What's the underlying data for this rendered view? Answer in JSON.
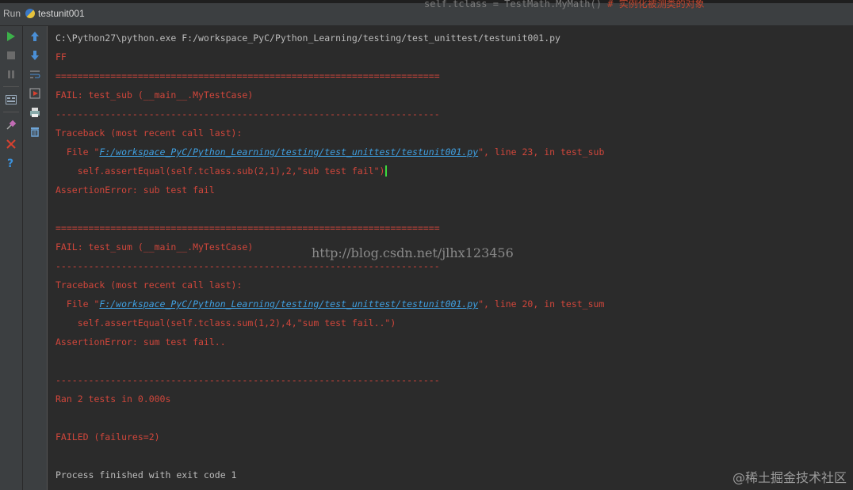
{
  "window": {
    "panel_label": "Run",
    "tab_label": "testunit001",
    "bg_code_text": "self.tclass = TestMath.MyMath()",
    "bg_code_suffix": "  # 实例化被测类的对象"
  },
  "toolbar_left": {
    "icons": [
      "run-icon",
      "stop-icon",
      "pause-icon",
      "layout-icon",
      "pin-icon",
      "close-icon",
      "help-icon"
    ]
  },
  "toolbar_right": {
    "icons": [
      "up-arrow-icon",
      "down-arrow-icon",
      "soft-wrap-icon",
      "scroll-to-end-icon",
      "print-icon",
      "trash-icon"
    ]
  },
  "console": {
    "lines": [
      {
        "text": "C:\\Python27\\python.exe F:/workspace_PyC/Python_Learning/testing/test_unittest/testunit001.py",
        "color": "gray"
      },
      {
        "text": "FF",
        "color": "red"
      },
      {
        "text": "======================================================================",
        "color": "red"
      },
      {
        "text": "FAIL: test_sub (__main__.MyTestCase)",
        "color": "red"
      },
      {
        "text": "----------------------------------------------------------------------",
        "color": "red"
      },
      {
        "text": "Traceback (most recent call last):",
        "color": "red"
      },
      {
        "text_pre": "  File \"",
        "link": "F:/workspace_PyC/Python_Learning/testing/test_unittest/testunit001.py",
        "text_post": "\", line 23, in test_sub",
        "color": "red"
      },
      {
        "text": "    self.assertEqual(self.tclass.sub(2,1),2,\"sub test fail\")",
        "color": "red",
        "caret": true
      },
      {
        "text": "AssertionError: sub test fail",
        "color": "red"
      },
      {
        "text": "",
        "color": "red"
      },
      {
        "text": "======================================================================",
        "color": "red"
      },
      {
        "text": "FAIL: test_sum (__main__.MyTestCase)",
        "color": "red"
      },
      {
        "text": "----------------------------------------------------------------------",
        "color": "red"
      },
      {
        "text": "Traceback (most recent call last):",
        "color": "red"
      },
      {
        "text_pre": "  File \"",
        "link": "F:/workspace_PyC/Python_Learning/testing/test_unittest/testunit001.py",
        "text_post": "\", line 20, in test_sum",
        "color": "red"
      },
      {
        "text": "    self.assertEqual(self.tclass.sum(1,2),4,\"sum test fail..\")",
        "color": "red"
      },
      {
        "text": "AssertionError: sum test fail..",
        "color": "red"
      },
      {
        "text": "",
        "color": "red"
      },
      {
        "text": "----------------------------------------------------------------------",
        "color": "red"
      },
      {
        "text": "Ran 2 tests in 0.000s",
        "color": "red"
      },
      {
        "text": "",
        "color": "red"
      },
      {
        "text": "FAILED (failures=2)",
        "color": "red"
      },
      {
        "text": "",
        "color": "red"
      },
      {
        "text": "Process finished with exit code 1",
        "color": "gray"
      }
    ]
  },
  "watermarks": {
    "blog_url": "http://blog.csdn.net/jlhx123456",
    "site": "@稀土掘金技术社区"
  },
  "colors": {
    "background": "#2b2b2b",
    "error_text": "#d0463b",
    "normal_text": "#bbbbbb",
    "link": "#3f9fe0",
    "caret": "#3ddc3d"
  }
}
